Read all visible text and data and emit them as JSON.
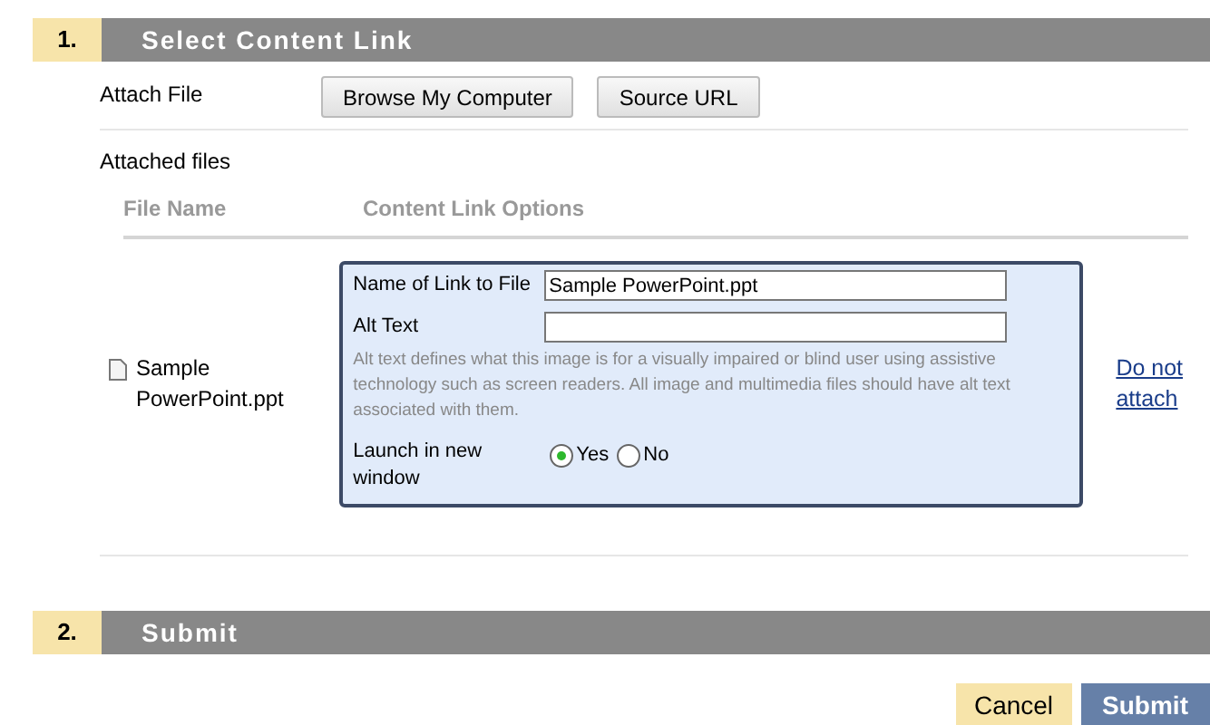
{
  "sections": [
    {
      "number": "1.",
      "title": "Select Content Link"
    },
    {
      "number": "2.",
      "title": "Submit"
    }
  ],
  "attach_file": {
    "label": "Attach File",
    "buttons": [
      "Browse My Computer",
      "Source URL"
    ]
  },
  "attached_files": {
    "label": "Attached files",
    "columns": [
      "File Name",
      "Content Link Options"
    ],
    "rows": [
      {
        "file_name": "Sample PowerPoint.ppt",
        "link_name_label": "Name of Link to File",
        "link_name_value": "Sample PowerPoint.ppt",
        "alt_text_label": "Alt Text",
        "alt_text_help": "Alt text defines what this image is for a visually impaired or blind user using assistive technology such as screen readers. All image and multimedia files should have alt text associated with them.",
        "launch_label": "Launch in new window",
        "options": [
          {
            "label": "Yes",
            "selected": true
          },
          {
            "label": "No",
            "selected": false
          }
        ],
        "action": "Do not attach"
      }
    ]
  },
  "footer_buttons": [
    "Cancel",
    "Submit"
  ]
}
